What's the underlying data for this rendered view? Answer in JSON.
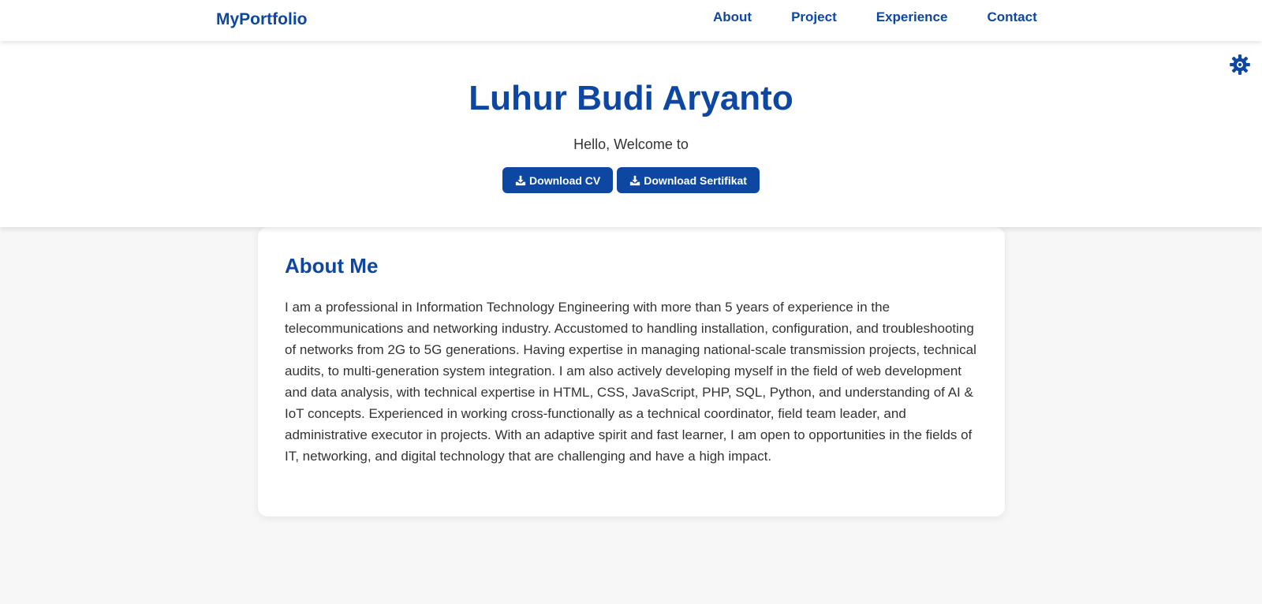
{
  "navbar": {
    "brand": "MyPortfolio",
    "links": [
      "About",
      "Project",
      "Experience",
      "Contact"
    ]
  },
  "hero": {
    "title": "Luhur Budi Aryanto",
    "subtitle": "Hello, Welcome to",
    "buttons": {
      "cv": "Download CV",
      "certificate": "Download Sertifikat"
    },
    "theme_toggle_icon": "gear-icon"
  },
  "about": {
    "title": "About Me",
    "text": "I am a professional in Information Technology Engineering with more than 5 years of experience in the telecommunications and networking industry. Accustomed to handling installation, configuration, and troubleshooting of networks from 2G to 5G generations. Having expertise in managing national-scale transmission projects, technical audits, to multi-generation system integration. I am also actively developing myself in the field of web development and data analysis, with technical expertise in HTML, CSS, JavaScript, PHP, SQL, Python, and understanding of AI & IoT concepts. Experienced in working cross-functionally as a technical coordinator, field team leader, and administrative executor in projects. With an adaptive spirit and fast learner, I am open to opportunities in the fields of IT, networking, and digital technology that are challenging and have a high impact."
  },
  "colors": {
    "primary": "#0d47a1",
    "background": "#f7f7f7",
    "text": "#333333"
  }
}
